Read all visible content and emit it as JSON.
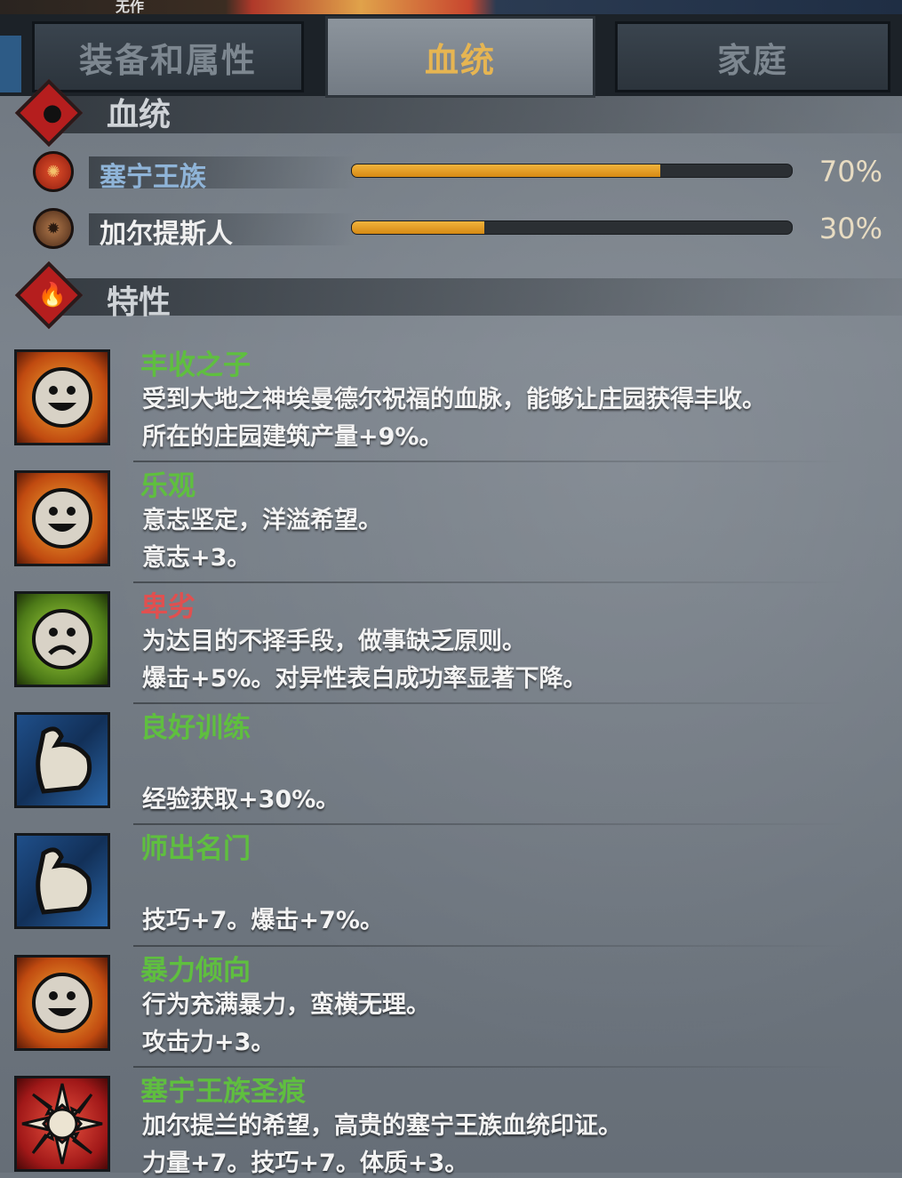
{
  "colors": {
    "accent_gold": "#e6b552",
    "trait_green": "#5fbf3f",
    "trait_red": "#e05050",
    "bloodline_name": "#8fb4d8",
    "bar_fill": "#e89c22"
  },
  "header": {
    "portrait_fragment": "无作"
  },
  "tabs": [
    {
      "label": "装备和属性",
      "active": false
    },
    {
      "label": "血统",
      "active": true
    },
    {
      "label": "家庭",
      "active": false
    }
  ],
  "bloodline_section": {
    "title": "血统",
    "icon": "blood-drop-icon"
  },
  "bloodlines": [
    {
      "name": "塞宁王族",
      "percent_label": "70%",
      "value": 0.7,
      "icon": "royal-crest-icon",
      "name_color": "#8fb4d8"
    },
    {
      "name": "加尔提斯人",
      "percent_label": "30%",
      "value": 0.3,
      "icon": "tribal-crest-icon",
      "name_color": "#f0f0f0"
    }
  ],
  "traits_section": {
    "title": "特性",
    "icon": "fire-icon"
  },
  "traits": [
    {
      "name": "丰收之子",
      "color": "#5fbf3f",
      "icon": "happy-face-icon",
      "desc": "受到大地之神埃曼德尔祝福的血脉，能够让庄园获得丰收。",
      "effect": "所在的庄园建筑产量+9%。"
    },
    {
      "name": "乐观",
      "color": "#5fbf3f",
      "icon": "happy-face-icon",
      "desc": "意志坚定，洋溢希望。",
      "effect": "意志+3。"
    },
    {
      "name": "卑劣",
      "color": "#e05050",
      "icon": "sad-face-icon",
      "desc": "为达目的不择手段，做事缺乏原则。",
      "effect": "爆击+5%。对异性表白成功率显著下降。"
    },
    {
      "name": "良好训练",
      "color": "#5fbf3f",
      "icon": "flexed-arm-icon",
      "desc": "",
      "effect": "经验获取+30%。"
    },
    {
      "name": "师出名门",
      "color": "#5fbf3f",
      "icon": "flexed-arm-icon",
      "desc": "",
      "effect": "技巧+7。爆击+7%。"
    },
    {
      "name": "暴力倾向",
      "color": "#5fbf3f",
      "icon": "happy-face-icon",
      "desc": "行为充满暴力，蛮横无理。",
      "effect": "攻击力+3。"
    },
    {
      "name": "塞宁王族圣痕",
      "color": "#5fbf3f",
      "icon": "sun-emblem-icon",
      "desc": "加尔提兰的希望，高贵的塞宁王族血统印证。",
      "effect": "力量+7。技巧+7。体质+3。"
    }
  ]
}
